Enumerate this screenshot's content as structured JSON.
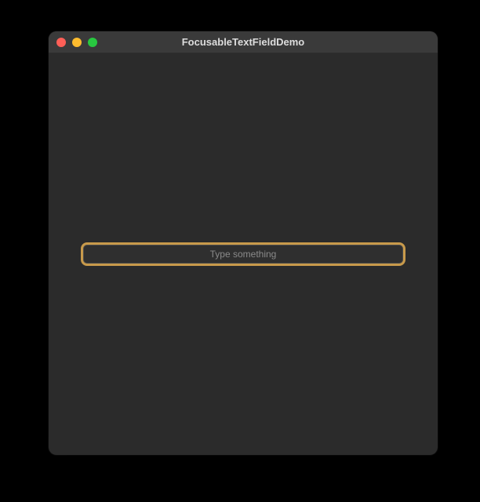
{
  "window": {
    "title": "FocusableTextFieldDemo"
  },
  "input": {
    "placeholder": "Type something",
    "value": ""
  },
  "colors": {
    "focus_ring": "#c89a4b"
  }
}
